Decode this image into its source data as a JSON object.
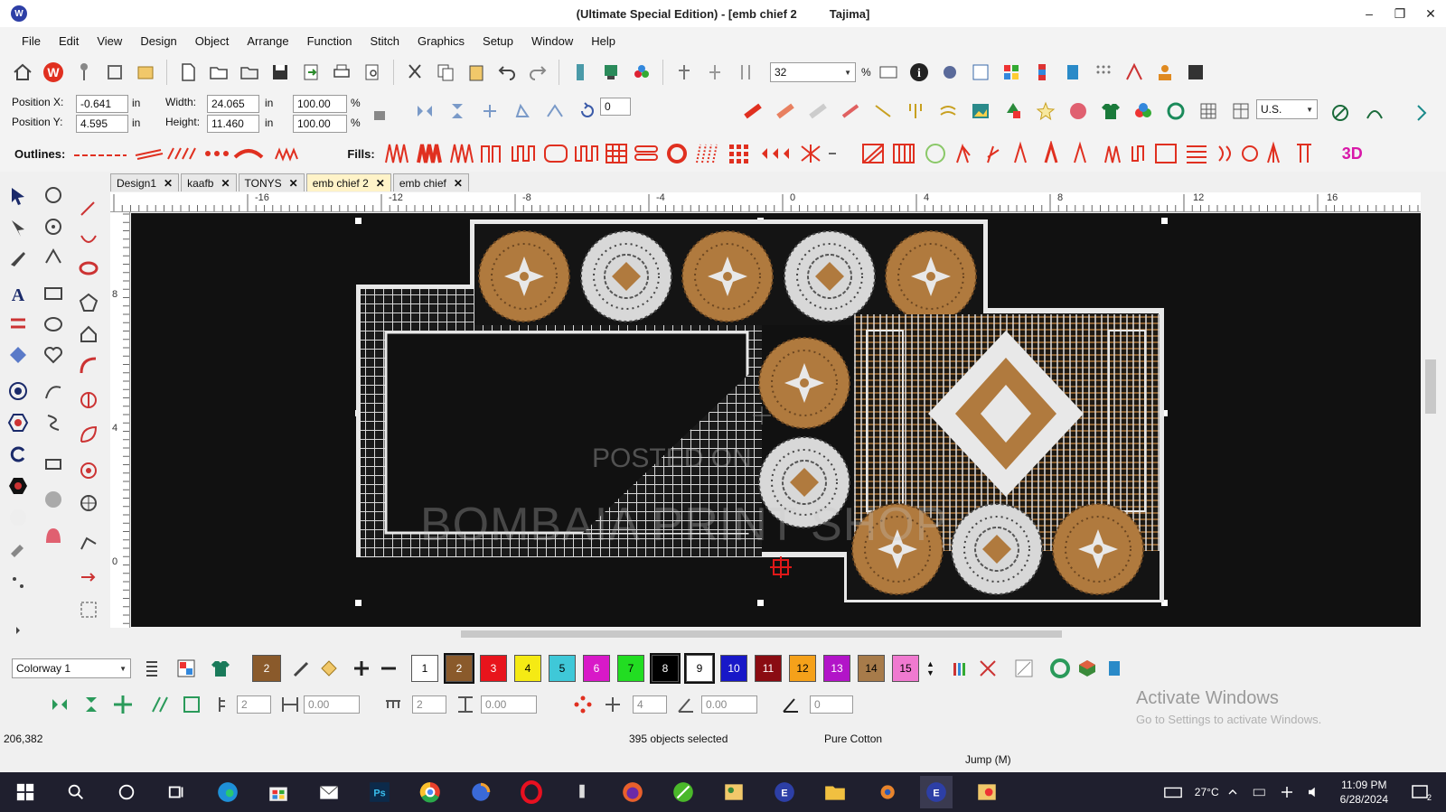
{
  "window": {
    "title_left": "(Ultimate Special Edition) - [emb chief 2",
    "title_right": "Tajima]",
    "min": "–",
    "max": "❐",
    "close": "✕"
  },
  "menu": [
    "File",
    "Edit",
    "View",
    "Design",
    "Object",
    "Arrange",
    "Function",
    "Stitch",
    "Graphics",
    "Setup",
    "Window",
    "Help"
  ],
  "toolbar": {
    "zoom_value": "32",
    "zoom_unit": "%",
    "units_value": "U.S."
  },
  "properties": {
    "pos_x_label": "Position X:",
    "pos_x": "-0.641",
    "pos_x_unit": "in",
    "pos_y_label": "Position Y:",
    "pos_y": "4.595",
    "pos_y_unit": "in",
    "width_label": "Width:",
    "width": "24.065",
    "width_unit": "in",
    "height_label": "Height:",
    "height": "11.460",
    "height_unit": "in",
    "scale_w": "100.00",
    "scale_w_unit": "%",
    "scale_h": "100.00",
    "scale_h_unit": "%",
    "rotate": "0"
  },
  "styles": {
    "outlines_label": "Outlines:",
    "fills_label": "Fills:",
    "three_d": "3D"
  },
  "tabs": [
    {
      "label": "Design1",
      "close": "✕"
    },
    {
      "label": "kaafb",
      "close": "✕"
    },
    {
      "label": "TONYS",
      "close": "✕"
    },
    {
      "label": "emb chief 2",
      "close": "✕"
    },
    {
      "label": "emb chief",
      "close": "✕"
    }
  ],
  "ruler_h": [
    "-16",
    "-12",
    "-8",
    "-4",
    "0",
    "4",
    "8",
    "12",
    "16"
  ],
  "ruler_v": [
    "8",
    "4",
    "0"
  ],
  "canvas": {
    "watermark_top": "POSTED ON",
    "watermark_main": "BOMBAIA PRINT SHOP"
  },
  "colorway": {
    "label": "Colorway 1",
    "current": "2"
  },
  "palette": [
    {
      "num": "1",
      "color": "#ffffff",
      "text": "#000000"
    },
    {
      "num": "2",
      "color": "#8a5a2b",
      "text": "#ffffff"
    },
    {
      "num": "3",
      "color": "#e8141c",
      "text": "#ffffff"
    },
    {
      "num": "4",
      "color": "#f5ea14",
      "text": "#000000"
    },
    {
      "num": "5",
      "color": "#3fc8d8",
      "text": "#000000"
    },
    {
      "num": "6",
      "color": "#d819c8",
      "text": "#ffffff"
    },
    {
      "num": "7",
      "color": "#22dd22",
      "text": "#000000"
    },
    {
      "num": "8",
      "color": "#000000",
      "text": "#ffffff"
    },
    {
      "num": "9",
      "color": "#ffffff",
      "text": "#000000"
    },
    {
      "num": "10",
      "color": "#1818c8",
      "text": "#ffffff"
    },
    {
      "num": "11",
      "color": "#8a0c12",
      "text": "#ffffff"
    },
    {
      "num": "12",
      "color": "#f5a11a",
      "text": "#000000"
    },
    {
      "num": "13",
      "color": "#b214c8",
      "text": "#ffffff"
    },
    {
      "num": "14",
      "color": "#a77b4a",
      "text": "#000000"
    },
    {
      "num": "15",
      "color": "#f07ad0",
      "text": "#000000"
    }
  ],
  "toolbar5": {
    "v1": "2",
    "v2": "0.00",
    "v3": "2",
    "v4": "0.00",
    "v5": "4",
    "v6": "0.00",
    "v7": "0"
  },
  "status": {
    "coords": "206,382",
    "selection": "395 objects selected",
    "fabric": "Pure Cotton",
    "mode": "Jump (M)"
  },
  "activation": {
    "main": "Activate Windows",
    "sub": "Go to Settings to activate Windows."
  },
  "tray": {
    "temp": "27°C",
    "time": "11:09 PM",
    "date": "6/28/2024",
    "notif": "2"
  },
  "colors": {
    "gold": "#b07a3e",
    "white_stitch": "#e8e8e8",
    "canvas_bg": "#111111"
  }
}
